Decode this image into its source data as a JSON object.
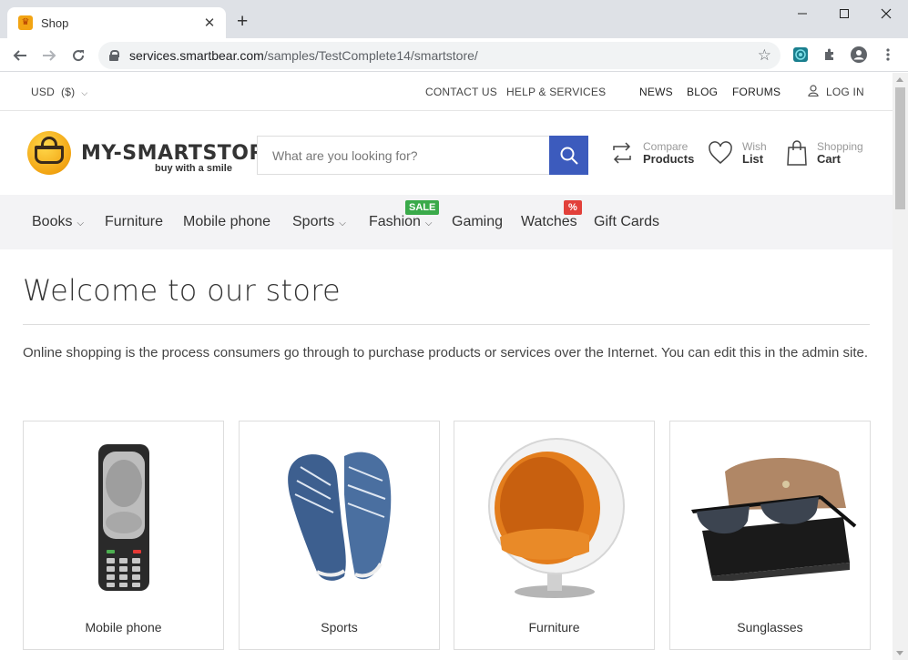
{
  "browser": {
    "tab_title": "Shop",
    "url_host": "services.smartbear.com",
    "url_path": "/samples/TestComplete14/smartstore/"
  },
  "topbar": {
    "currency": "USD",
    "currency_symbol": "($)",
    "contact": "CONTACT US",
    "help": "HELP & SERVICES",
    "news": "NEWS",
    "blog": "BLOG",
    "forums": "FORUMS",
    "login": "LOG IN"
  },
  "header": {
    "logo_text": "MY-SMARTSTORE",
    "logo_sub": "buy with a smile",
    "search_placeholder": "What are you looking for?",
    "compare_small": "Compare",
    "compare_big": "Products",
    "wish_small": "Wish",
    "wish_big": "List",
    "cart_small": "Shopping",
    "cart_big": "Cart"
  },
  "menu": {
    "items": [
      "Books",
      "Furniture",
      "Mobile phone",
      "Sports",
      "Fashion",
      "Gaming",
      "Watches",
      "Gift Cards"
    ],
    "sale_badge": "SALE",
    "percent_badge": "%",
    "sale_color": "#3aaa4a",
    "percent_color": "#e2403a"
  },
  "main": {
    "title": "Welcome to our store",
    "intro": "Online shopping is the process consumers go through to purchase products or services over the Internet. You can edit this in the admin site."
  },
  "categories": [
    "Mobile phone",
    "Sports",
    "Furniture",
    "Sunglasses"
  ],
  "colors": {
    "accent": "#3c5bbd"
  }
}
